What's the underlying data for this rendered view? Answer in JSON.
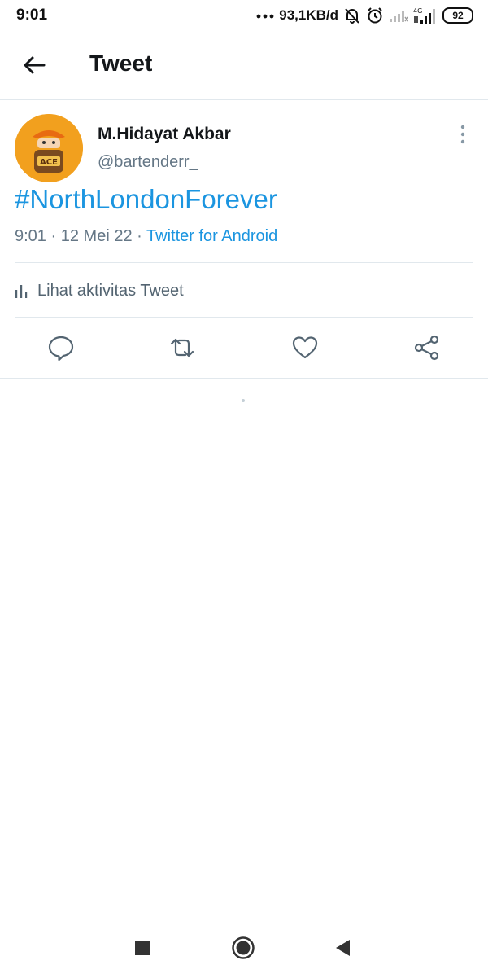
{
  "status_bar": {
    "time": "9:01",
    "net_speed": "93,1KB/d",
    "battery": "92",
    "icons": [
      "dots-icon",
      "mute-bell-icon",
      "alarm-icon",
      "signal-icon",
      "4g-signal-icon",
      "battery-icon"
    ]
  },
  "header": {
    "title": "Tweet",
    "back_icon": "back-arrow-icon"
  },
  "tweet": {
    "author_name": "M.Hidayat Akbar",
    "author_handle": "@bartenderr_",
    "avatar_text": "ACE",
    "text": "#NorthLondonForever",
    "time": "9:01",
    "date": "12 Mei 22",
    "source": "Twitter for Android",
    "sep": "·",
    "activity_label": "Lihat aktivitas Tweet",
    "actions": [
      "reply-icon",
      "retweet-icon",
      "like-icon",
      "share-icon"
    ]
  },
  "colors": {
    "accent": "#1b95e0",
    "secondary_text": "#657786",
    "divider": "#e1e8ed",
    "avatar_bg": "#f2a01e"
  },
  "nav_bar": {
    "icons": [
      "recents-square-icon",
      "home-circle-icon",
      "back-triangle-icon"
    ]
  }
}
